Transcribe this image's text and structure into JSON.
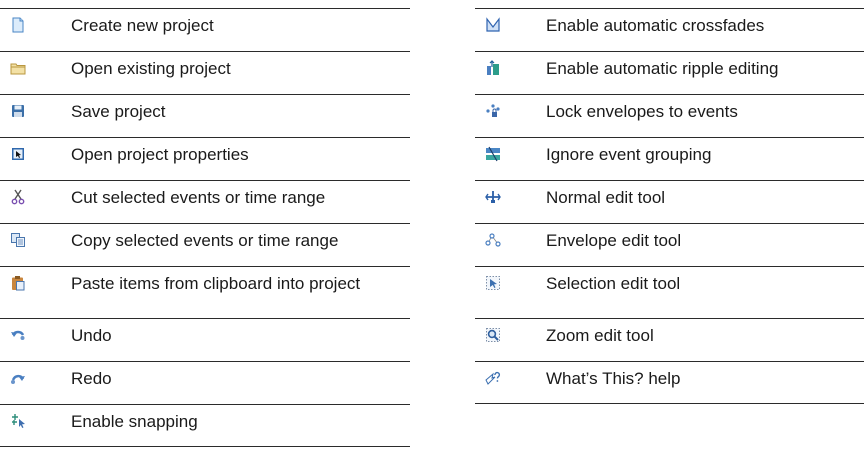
{
  "left_rows": [
    {
      "icon": "new-document-icon",
      "label": "Create new project"
    },
    {
      "icon": "open-folder-icon",
      "label": "Open existing project"
    },
    {
      "icon": "floppy-disk-icon",
      "label": "Save project"
    },
    {
      "icon": "project-properties-icon",
      "label": "Open project properties"
    },
    {
      "icon": "scissors-icon",
      "label": "Cut selected events or time range"
    },
    {
      "icon": "copy-icon",
      "label": "Copy selected events or time range"
    },
    {
      "icon": "paste-clipboard-icon",
      "label": "Paste items from clipboard into project"
    },
    {
      "icon": "undo-icon",
      "label": "Undo"
    },
    {
      "icon": "redo-icon",
      "label": "Redo"
    },
    {
      "icon": "snapping-icon",
      "label": "Enable snapping"
    }
  ],
  "right_rows": [
    {
      "icon": "crossfade-icon",
      "label": "Enable automatic crossfades"
    },
    {
      "icon": "ripple-edit-icon",
      "label": "Enable automatic ripple editing"
    },
    {
      "icon": "lock-envelope-icon",
      "label": "Lock envelopes to events"
    },
    {
      "icon": "ignore-grouping-icon",
      "label": "Ignore event grouping"
    },
    {
      "icon": "normal-edit-tool-icon",
      "label": "Normal edit tool"
    },
    {
      "icon": "envelope-edit-tool-icon",
      "label": "Envelope edit tool"
    },
    {
      "icon": "selection-edit-tool-icon",
      "label": "Selection edit tool"
    },
    {
      "icon": "zoom-edit-tool-icon",
      "label": "Zoom edit tool"
    },
    {
      "icon": "whats-this-help-icon",
      "label": "What’s This? help"
    }
  ]
}
